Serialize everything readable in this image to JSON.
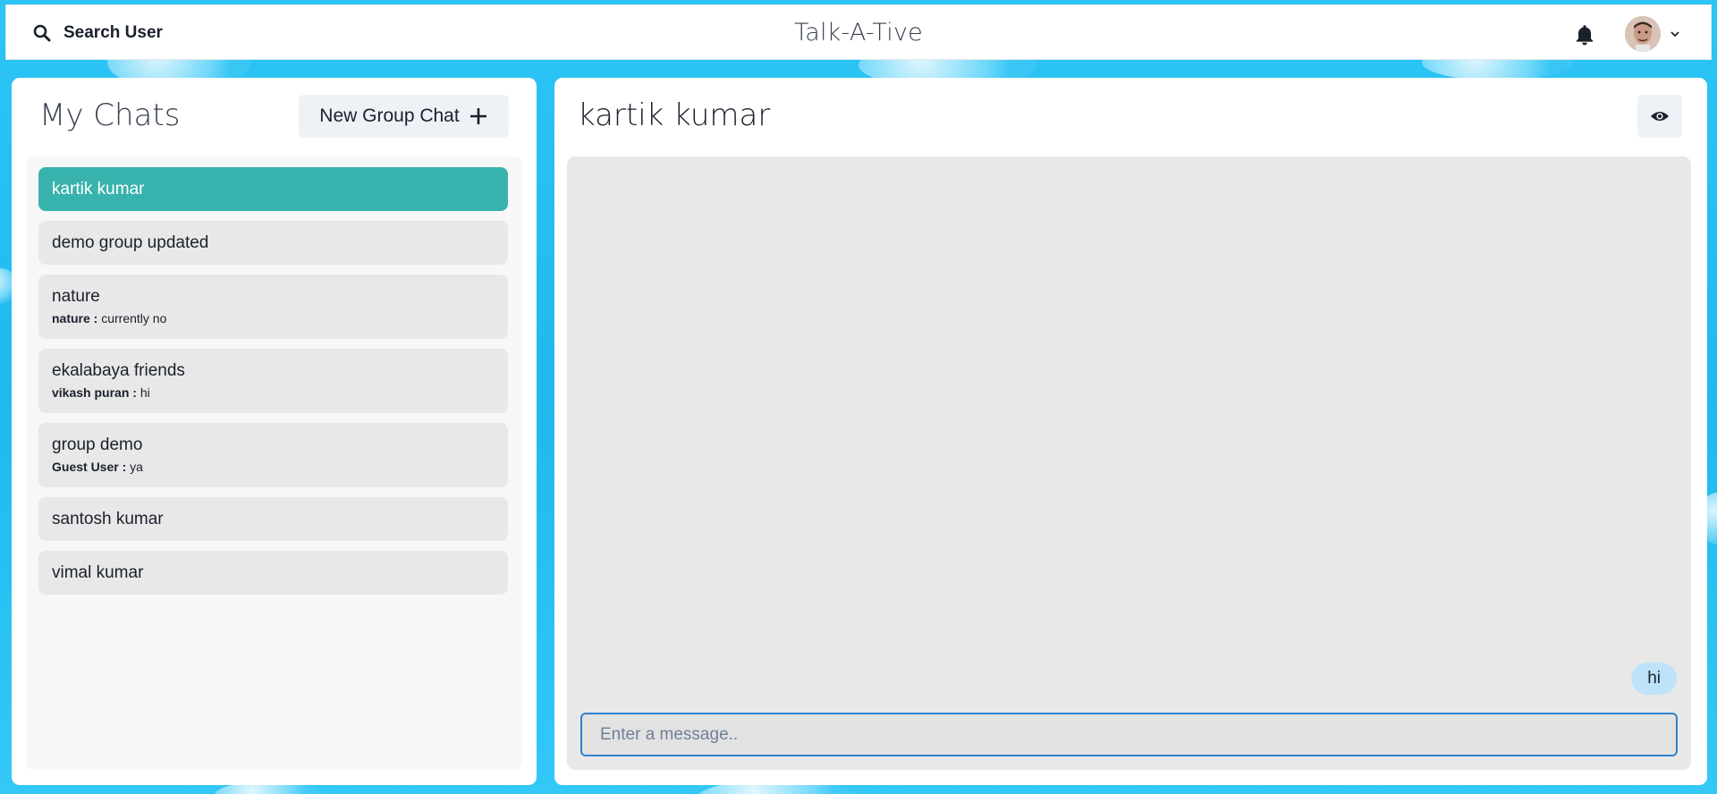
{
  "header": {
    "search_label": "Search User",
    "app_title": "Talk-A-Tive"
  },
  "sidebar": {
    "title": "My Chats",
    "new_group_label": "New Group Chat",
    "chats": [
      {
        "name": "kartik kumar",
        "sender": "",
        "message": "",
        "active": true
      },
      {
        "name": "demo group updated",
        "sender": "",
        "message": "",
        "active": false
      },
      {
        "name": "nature",
        "sender": "nature :",
        "message": "currently no",
        "active": false
      },
      {
        "name": "ekalabaya friends",
        "sender": "vikash puran :",
        "message": "hi",
        "active": false
      },
      {
        "name": "group demo",
        "sender": "Guest User :",
        "message": "ya",
        "active": false
      },
      {
        "name": "santosh kumar",
        "sender": "",
        "message": "",
        "active": false
      },
      {
        "name": "vimal kumar",
        "sender": "",
        "message": "",
        "active": false
      }
    ]
  },
  "chat": {
    "title": "kartik kumar",
    "messages": [
      {
        "text": "hi",
        "own": true
      }
    ],
    "input_placeholder": "Enter a message.."
  },
  "colors": {
    "accent": "#38b2ac",
    "bubble_own": "#bee3f8",
    "input_border": "#3182ce",
    "background": "#2cc5f5"
  }
}
